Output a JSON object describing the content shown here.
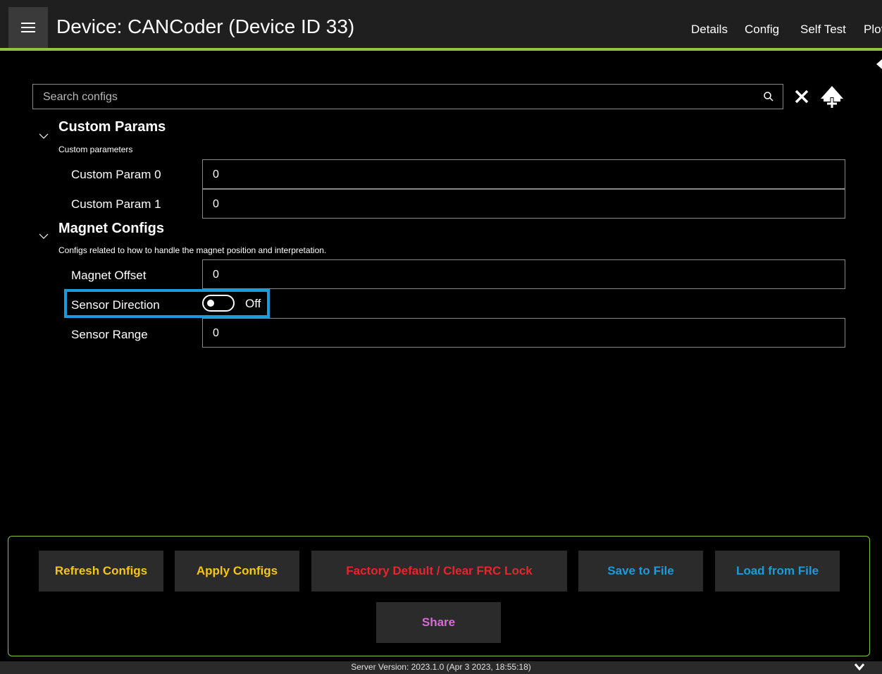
{
  "header": {
    "title": "Device: CANCoder (Device ID 33)",
    "nav": [
      "Details",
      "Config",
      "Self Test",
      "Plot"
    ],
    "accent_color": "#8cc63f"
  },
  "search": {
    "placeholder": "Search configs",
    "value": ""
  },
  "sections": [
    {
      "title": "Custom Params",
      "description": "Custom parameters",
      "rows": [
        {
          "label": "Custom Param 0",
          "value": "0"
        },
        {
          "label": "Custom Param 1",
          "value": "0"
        }
      ]
    },
    {
      "title": "Magnet Configs",
      "description": "Configs related to how to handle the magnet position and interpretation.",
      "rows": [
        {
          "label": "Magnet Offset",
          "value": "0"
        },
        {
          "label": "Sensor Direction",
          "toggle_state": "Off"
        },
        {
          "label": "Sensor Range",
          "value": "0"
        }
      ]
    }
  ],
  "buttons": {
    "refresh": {
      "label": "Refresh Configs",
      "color": "#f5c518"
    },
    "apply": {
      "label": "Apply Configs",
      "color": "#f5c518"
    },
    "factory": {
      "label": "Factory Default / Clear FRC Lock",
      "color": "#e8252b"
    },
    "save": {
      "label": "Save to File",
      "color": "#1a9bdc"
    },
    "load": {
      "label": "Load from File",
      "color": "#1a9bdc"
    },
    "share": {
      "label": "Share",
      "color": "#d86bd8"
    }
  },
  "footer": {
    "text": "Server Version:  2023.1.0 (Apr  3 2023, 18:55:18)"
  },
  "highlight_color": "#1a9bdc"
}
